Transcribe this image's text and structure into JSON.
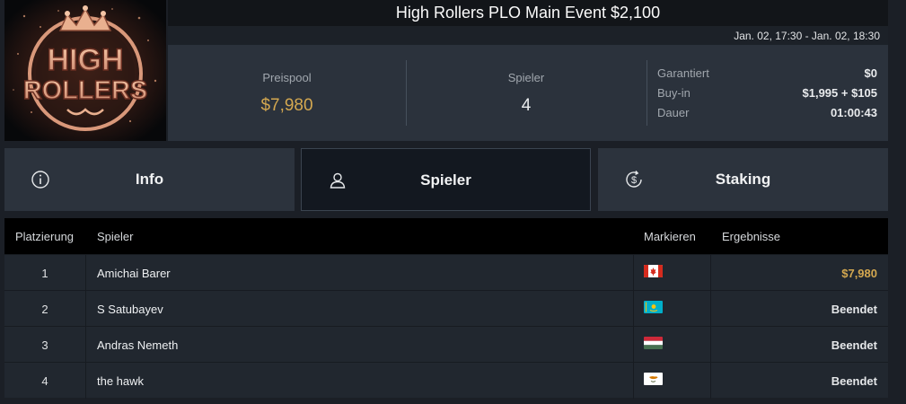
{
  "logo": {
    "line1": "HIGH",
    "line2": "ROLLERS"
  },
  "header": {
    "title": "High Rollers PLO Main Event $2,100",
    "dates": "Jan. 02, 17:30 - Jan. 02, 18:30"
  },
  "stats": {
    "prizepool_label": "Preispool",
    "prizepool_value": "$7,980",
    "players_label": "Spieler",
    "players_value": "4",
    "details": [
      {
        "label": "Garantiert",
        "value": "$0"
      },
      {
        "label": "Buy-in",
        "value": "$1,995 + $105"
      },
      {
        "label": "Dauer",
        "value": "01:00:43"
      }
    ]
  },
  "tabs": [
    {
      "label": "Info",
      "icon": "info-icon",
      "active": false
    },
    {
      "label": "Spieler",
      "icon": "user-icon",
      "active": true
    },
    {
      "label": "Staking",
      "icon": "dollar-cycle-icon",
      "active": false
    }
  ],
  "table": {
    "headers": {
      "place": "Platzierung",
      "player": "Spieler",
      "mark": "Markieren",
      "result": "Ergebnisse"
    },
    "rows": [
      {
        "place": "1",
        "player": "Amichai Barer",
        "flag": "canada-flag",
        "result": "$7,980"
      },
      {
        "place": "2",
        "player": "S Satubayev",
        "flag": "kazakhstan-flag",
        "result": "Beendet"
      },
      {
        "place": "3",
        "player": "Andras Nemeth",
        "flag": "hungary-flag",
        "result": "Beendet"
      },
      {
        "place": "4",
        "player": "the hawk",
        "flag": "cyprus-flag",
        "result": "Beendet"
      }
    ]
  },
  "colors": {
    "gold": "#d4a850",
    "active_tab": "#131820",
    "tab": "#2c333d"
  }
}
